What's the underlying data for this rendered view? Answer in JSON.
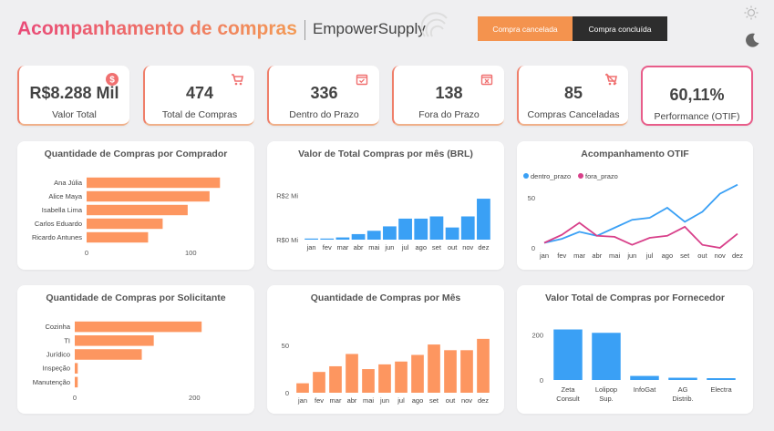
{
  "header": {
    "title": "Acompanhamento de compras",
    "brand": "EmpowerSupply",
    "tabs": [
      {
        "label": "Compra cancelada",
        "color": "#f4934e"
      },
      {
        "label": "Compra concluída",
        "color": "#2d2d2d"
      }
    ],
    "icons": [
      "sun-icon",
      "moon-icon"
    ]
  },
  "kpis": [
    {
      "value": "R$8.288 Mil",
      "label": "Valor Total",
      "icon": "dollar-icon"
    },
    {
      "value": "474",
      "label": "Total de Compras",
      "icon": "cart-icon"
    },
    {
      "value": "336",
      "label": "Dentro do Prazo",
      "icon": "calendar-check-icon"
    },
    {
      "value": "138",
      "label": "Fora do Prazo",
      "icon": "calendar-x-icon"
    },
    {
      "value": "85",
      "label": "Compras Canceladas",
      "icon": "cart-cancel-icon"
    },
    {
      "value": "60,11%",
      "label": "Performance (OTIF)",
      "icon": ""
    }
  ],
  "colors": {
    "orange": "#fd9660",
    "blue": "#3aa0f5",
    "pink": "#d8408a"
  },
  "chart_data": [
    {
      "id": "comprador",
      "type": "bar",
      "orientation": "horizontal",
      "title": "Quantidade de Compras por Comprador",
      "categories": [
        "Ana Júlia",
        "Alice Maya",
        "Isabella Lima",
        "Carlos Eduardo",
        "Ricardo Antunes"
      ],
      "values": [
        128,
        118,
        97,
        73,
        59
      ],
      "xlim": [
        0,
        140
      ],
      "xticks": [
        "0",
        "100"
      ]
    },
    {
      "id": "valor_mes",
      "type": "bar",
      "title": "Valor de Total Compras por mês (BRL)",
      "categories": [
        "jan",
        "fev",
        "mar",
        "abr",
        "mai",
        "jun",
        "jul",
        "ago",
        "set",
        "out",
        "nov",
        "dez"
      ],
      "values": [
        0.05,
        0.05,
        0.1,
        0.25,
        0.4,
        0.6,
        0.95,
        0.95,
        1.05,
        0.55,
        1.05,
        1.85,
        2.55
      ],
      "ylim": [
        0,
        2.8
      ],
      "yticks": [
        "R$0 Mi",
        "R$2 Mi"
      ]
    },
    {
      "id": "otif",
      "type": "line",
      "title": "Acompanhamento OTIF",
      "categories": [
        "jan",
        "fev",
        "mar",
        "abr",
        "mai",
        "jun",
        "jul",
        "ago",
        "set",
        "out",
        "nov",
        "dez"
      ],
      "series": [
        {
          "name": "dentro_prazo",
          "values": [
            5,
            9,
            16,
            12,
            20,
            28,
            30,
            40,
            26,
            36,
            54,
            63
          ]
        },
        {
          "name": "fora_prazo",
          "values": [
            5,
            13,
            25,
            12,
            11,
            3,
            10,
            12,
            21,
            3,
            0,
            14
          ]
        }
      ],
      "ylim": [
        0,
        70
      ],
      "yticks": [
        "0",
        "50"
      ]
    },
    {
      "id": "solicitante",
      "type": "bar",
      "orientation": "horizontal",
      "title": "Quantidade de Compras por Solicitante",
      "categories": [
        "Cozinha",
        "TI",
        "Jurídico",
        "Inspeção",
        "Manutenção"
      ],
      "values": [
        212,
        132,
        112,
        5,
        5
      ],
      "xlim": [
        0,
        230
      ],
      "xticks": [
        "0",
        "200"
      ]
    },
    {
      "id": "qtd_mes",
      "type": "bar",
      "title": "Quantidade de Compras por Mês",
      "categories": [
        "jan",
        "fev",
        "mar",
        "abr",
        "mai",
        "jun",
        "jul",
        "ago",
        "set",
        "out",
        "nov",
        "dez"
      ],
      "values": [
        10,
        22,
        28,
        41,
        25,
        30,
        33,
        40,
        51,
        45,
        45,
        57,
        76
      ],
      "ylim": [
        0,
        80
      ],
      "yticks": [
        "0",
        "50"
      ]
    },
    {
      "id": "fornecedor",
      "type": "bar",
      "title": "Valor Total de Compras por Fornecedor",
      "categories": [
        "Zeta Consult",
        "Lolipop Sup.",
        "InfoGat",
        "AG Distrib.",
        "Electra"
      ],
      "values": [
        225,
        210,
        18,
        10,
        8
      ],
      "ylim": [
        0,
        280
      ],
      "yticks": [
        "0",
        "200"
      ]
    }
  ]
}
